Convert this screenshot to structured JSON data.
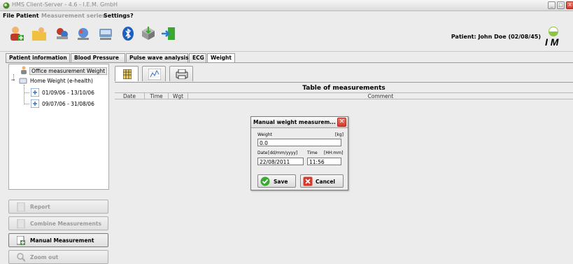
{
  "window": {
    "title": "HMS Client-Server - 4.6 - I.E.M. GmbH",
    "controls": [
      "_",
      "□",
      "X"
    ]
  },
  "menu": [
    {
      "label": "File",
      "enabled": true
    },
    {
      "label": "Patient",
      "enabled": true
    },
    {
      "label": "Measurement series",
      "enabled": false
    },
    {
      "label": "Settings",
      "enabled": true
    },
    {
      "label": "?",
      "enabled": true
    }
  ],
  "toolbar": {
    "icons": [
      "add-patient-icon",
      "open-folder-icon",
      "patient-list-icon",
      "transfer-icon",
      "device-icon",
      "bluetooth-icon",
      "install-icon",
      "exit-icon"
    ],
    "patient_label": "Patient: John Doe (02/08/45)",
    "logo_text": "I M"
  },
  "tabs": [
    "Patient information",
    "Blood Pressure",
    "Pulse wave analysis",
    "ECG",
    "Weight"
  ],
  "active_tab": "Weight",
  "tree": {
    "root": "Office measurement Weight",
    "group": "Home Weight (e-health)",
    "children": [
      "01/09/06 - 13/10/06",
      "09/07/06 - 31/08/06"
    ]
  },
  "side_buttons": [
    {
      "label": "Report",
      "enabled": false
    },
    {
      "label": "Combine Measurements",
      "enabled": false
    },
    {
      "label": "Manual Measurement",
      "enabled": true
    },
    {
      "label": "Zoom out",
      "enabled": false
    }
  ],
  "subtabs": [
    "table-view-icon",
    "chart-view-icon",
    "print-view-icon"
  ],
  "table": {
    "title": "Table of measurements",
    "columns": [
      "Date",
      "Time",
      "Wgt",
      "Comment"
    ]
  },
  "dialog": {
    "title": "Manual weight measurem...",
    "weight_label": "Weight",
    "weight_unit": "[kg]",
    "weight_value": "0.0",
    "date_label": "Date",
    "date_format": "[dd/mm/yyyy]",
    "time_label": "Time",
    "time_format": "[HH:mm]",
    "date_value": "22/08/2011",
    "time_value": "11:56",
    "save_label": "Save",
    "cancel_label": "Cancel"
  },
  "colors": {
    "save_green": "#3aa832",
    "cancel_red": "#d33a2c",
    "accent_blue": "#3b74c4"
  }
}
